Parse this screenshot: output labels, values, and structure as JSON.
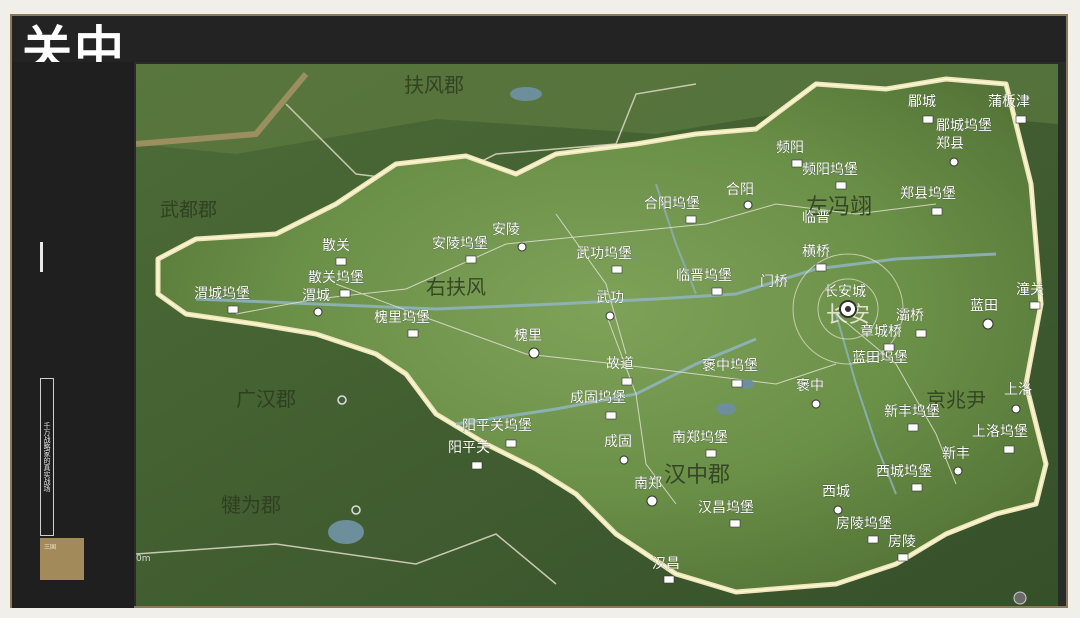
{
  "header": {
    "title": "关中"
  },
  "sidebar": {
    "tagline": "千万战略家的真实战场",
    "badge_text": "三国"
  },
  "map": {
    "commanderies": [
      {
        "name": "扶风郡"
      },
      {
        "name": "武都郡"
      },
      {
        "name": "右扶风"
      },
      {
        "name": "左冯翊"
      },
      {
        "name": "京兆尹"
      },
      {
        "name": "广汉郡"
      },
      {
        "name": "汉中郡"
      },
      {
        "name": "犍为郡"
      },
      {
        "name": "长安"
      }
    ],
    "places": [
      {
        "name": "郿城"
      },
      {
        "name": "蒲板津"
      },
      {
        "name": "郿城坞堡"
      },
      {
        "name": "郑县"
      },
      {
        "name": "频阳"
      },
      {
        "name": "频阳坞堡"
      },
      {
        "name": "合阳"
      },
      {
        "name": "郑县坞堡"
      },
      {
        "name": "合阳坞堡"
      },
      {
        "name": "临晋"
      },
      {
        "name": "安陵"
      },
      {
        "name": "安陵坞堡"
      },
      {
        "name": "散关"
      },
      {
        "name": "散关坞堡"
      },
      {
        "name": "武功坞堡"
      },
      {
        "name": "横桥"
      },
      {
        "name": "渭城坞堡"
      },
      {
        "name": "渭城"
      },
      {
        "name": "临晋坞堡"
      },
      {
        "name": "门桥"
      },
      {
        "name": "长安城"
      },
      {
        "name": "潼关"
      },
      {
        "name": "武功"
      },
      {
        "name": "灞桥"
      },
      {
        "name": "蓝田"
      },
      {
        "name": "槐里坞堡"
      },
      {
        "name": "章城桥"
      },
      {
        "name": "槐里"
      },
      {
        "name": "蓝田坞堡"
      },
      {
        "name": "故道"
      },
      {
        "name": "褒中坞堡"
      },
      {
        "name": "褒中"
      },
      {
        "name": "上洛"
      },
      {
        "name": "成固坞堡"
      },
      {
        "name": "新丰坞堡"
      },
      {
        "name": "阳平关坞堡"
      },
      {
        "name": "上洛坞堡"
      },
      {
        "name": "南郑坞堡"
      },
      {
        "name": "阳平关"
      },
      {
        "name": "成固"
      },
      {
        "name": "新丰"
      },
      {
        "name": "西城坞堡"
      },
      {
        "name": "南郑"
      },
      {
        "name": "西城"
      },
      {
        "name": "汉昌坞堡"
      },
      {
        "name": "房陵坞堡"
      },
      {
        "name": "房陵"
      },
      {
        "name": "汉昌"
      }
    ],
    "scale": "0m"
  }
}
